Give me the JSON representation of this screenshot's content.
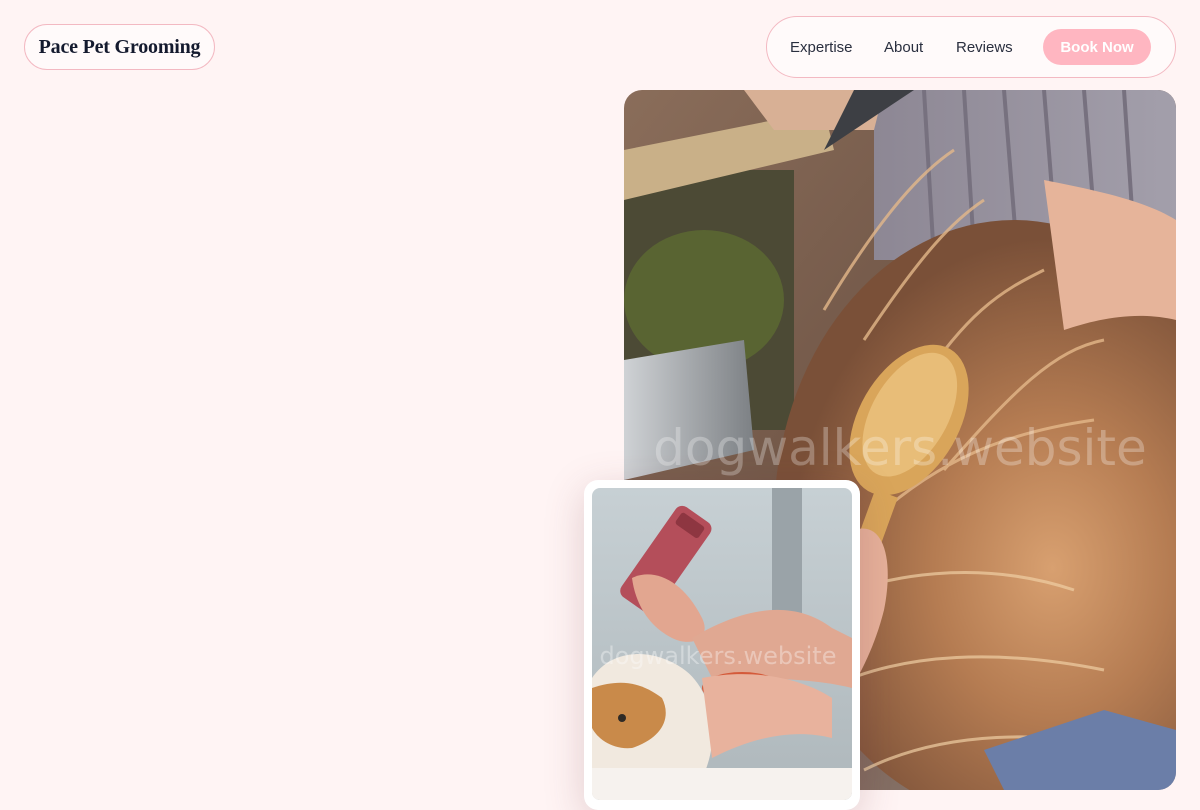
{
  "brand": {
    "name": "Pace Pet Grooming"
  },
  "nav": {
    "items": [
      "Expertise",
      "About",
      "Reviews"
    ],
    "cta_label": "Book Now"
  },
  "hero": {
    "main_photo_watermark": "dogwalkers.website",
    "inset_photo_watermark": "dogwalkers.website"
  },
  "colors": {
    "background": "#fff4f4",
    "accent": "#ffb6c1",
    "border": "#f3b9c2",
    "text_dark": "#141a2e"
  }
}
